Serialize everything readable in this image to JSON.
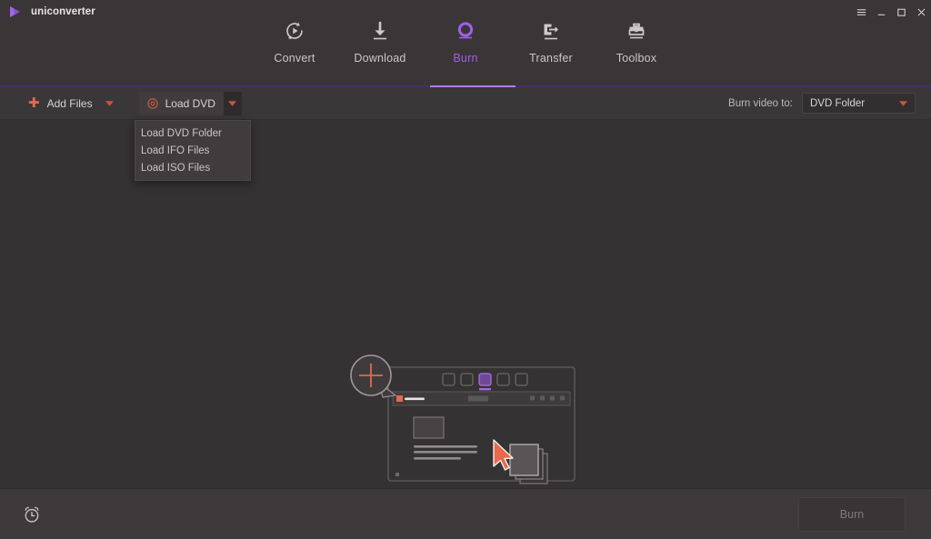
{
  "app": {
    "brand": "uniconverter",
    "logo_icon": "play-triangle-logo",
    "accent_purple": "#a25ee8",
    "accent_salmon": "#e06a50",
    "bg": "#353233"
  },
  "titlebar": {
    "controls": [
      {
        "name": "menu-button",
        "icon": "hamburger-icon",
        "glyph": "☰"
      },
      {
        "name": "minimize-button",
        "icon": "minimize-icon",
        "glyph": "–"
      },
      {
        "name": "maximize-button",
        "icon": "maximize-icon",
        "glyph": "□"
      },
      {
        "name": "close-button",
        "icon": "close-icon",
        "glyph": "✕"
      }
    ]
  },
  "nav": {
    "tabs": [
      {
        "label": "Convert",
        "icon": "convert-icon",
        "active": false
      },
      {
        "label": "Download",
        "icon": "download-icon",
        "active": false
      },
      {
        "label": "Burn",
        "icon": "burn-disc-icon",
        "active": true
      },
      {
        "label": "Transfer",
        "icon": "transfer-icon",
        "active": false
      },
      {
        "label": "Toolbox",
        "icon": "toolbox-icon",
        "active": false
      }
    ],
    "active_index": 2
  },
  "toolbar": {
    "add_files": {
      "label": "Add Files",
      "icon": "plus-icon",
      "caret": "chevron-down-icon"
    },
    "load_dvd": {
      "label": "Load DVD",
      "icon": "disc-icon",
      "caret": "chevron-down-icon",
      "open": true
    },
    "burn_to_label": "Burn video to:",
    "burn_to_value": "DVD Folder",
    "burn_to_options": [
      "DVD Folder"
    ]
  },
  "dropdown": {
    "items": [
      {
        "label": "Load DVD Folder"
      },
      {
        "label": "Load IFO Files"
      },
      {
        "label": "Load ISO Files"
      }
    ]
  },
  "canvas": {
    "illustration": "add-files-placeholder-illustration",
    "parts": {
      "magnifier": "magnifier-plus-icon",
      "window": "window-mockup",
      "cursor": "cursor-arrow-icon",
      "files": "stacked-files-icon"
    }
  },
  "footer": {
    "timer_icon": "alarm-clock-icon",
    "burn_button": {
      "label": "Burn",
      "enabled": false
    }
  }
}
